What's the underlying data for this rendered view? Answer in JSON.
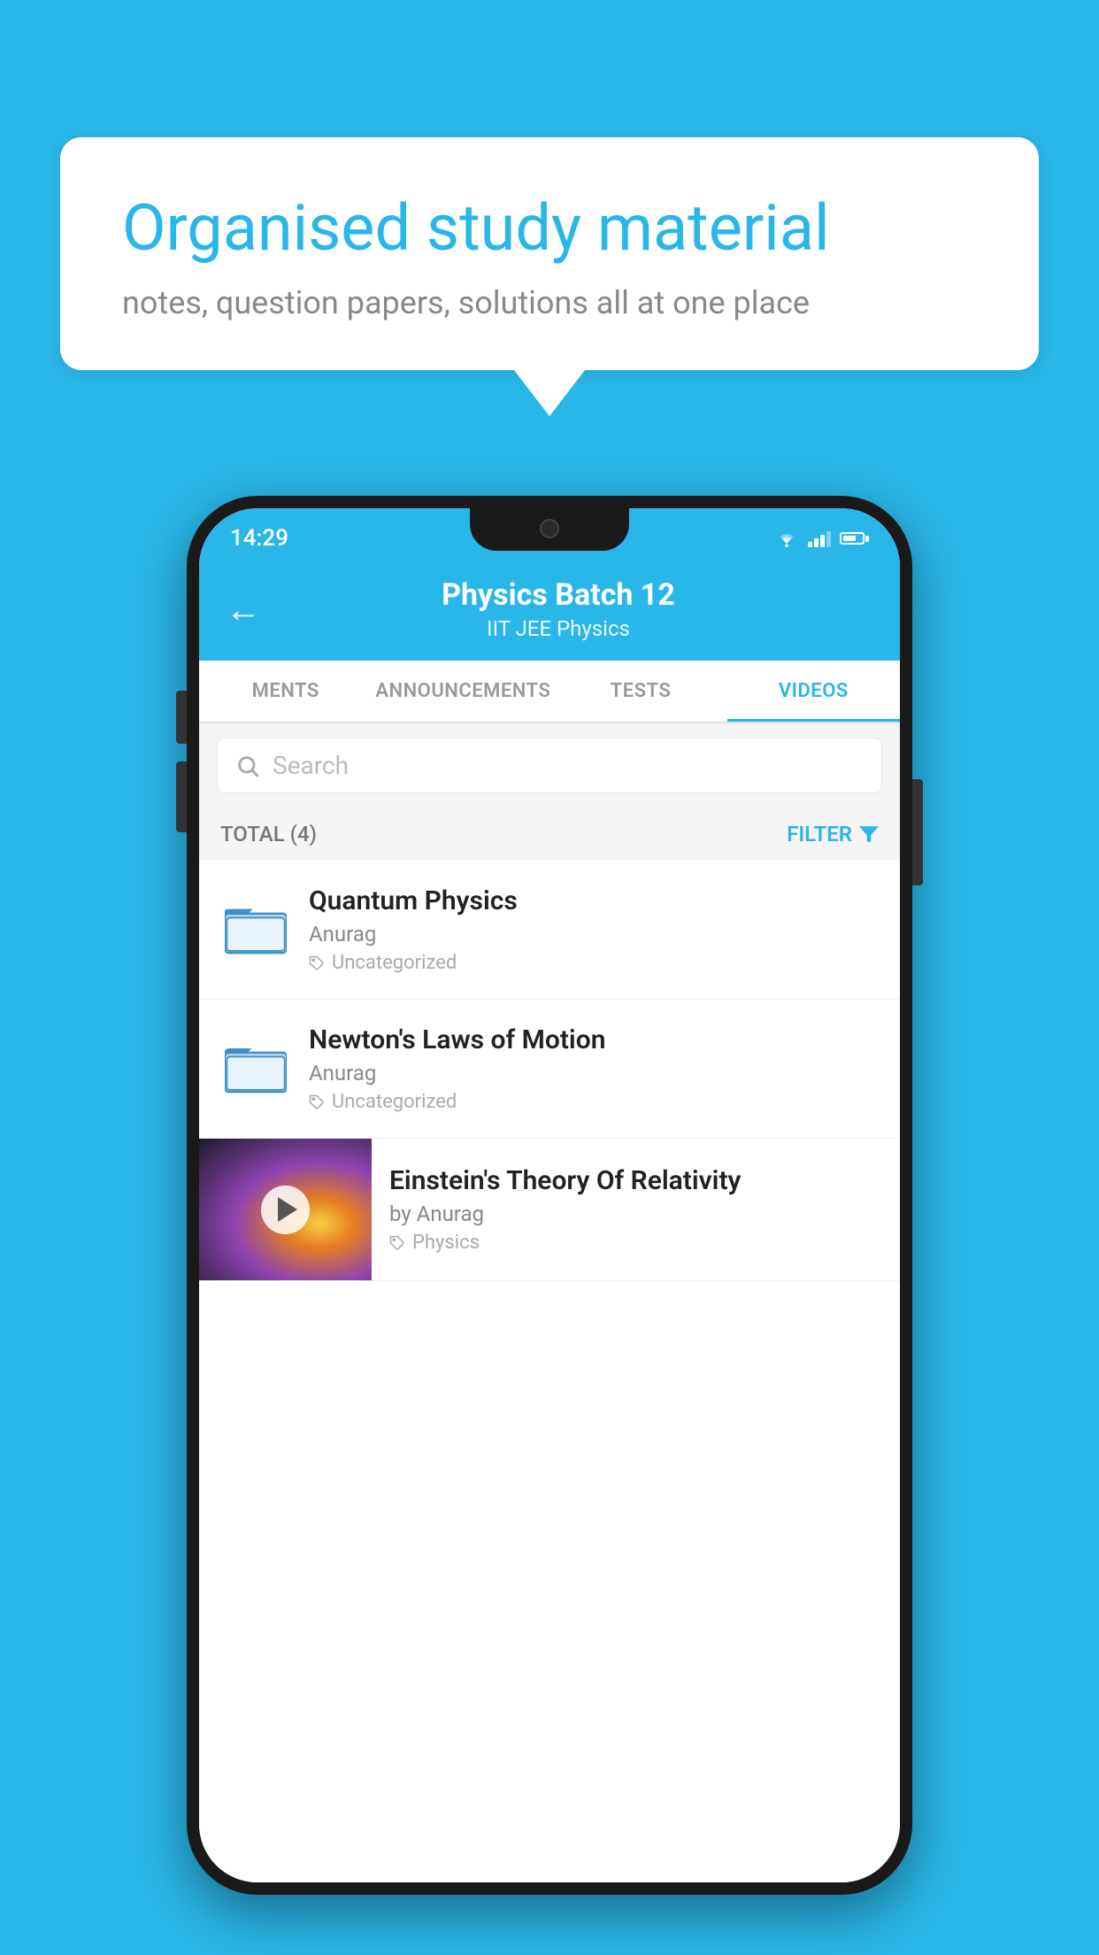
{
  "background_color": "#29b6e8",
  "speech_bubble": {
    "title": "Organised study material",
    "subtitle": "notes, question papers, solutions all at one place"
  },
  "phone": {
    "status_bar": {
      "time": "14:29"
    },
    "header": {
      "back_label": "←",
      "title": "Physics Batch 12",
      "subtitle": "IIT JEE   Physics"
    },
    "tabs": [
      {
        "label": "MENTS",
        "active": false
      },
      {
        "label": "ANNOUNCEMENTS",
        "active": false
      },
      {
        "label": "TESTS",
        "active": false
      },
      {
        "label": "VIDEOS",
        "active": true
      }
    ],
    "search": {
      "placeholder": "Search"
    },
    "filter_row": {
      "total_label": "TOTAL (4)",
      "filter_label": "FILTER"
    },
    "list_items": [
      {
        "id": 1,
        "type": "folder",
        "title": "Quantum Physics",
        "author": "Anurag",
        "tag": "Uncategorized"
      },
      {
        "id": 2,
        "type": "folder",
        "title": "Newton's Laws of Motion",
        "author": "Anurag",
        "tag": "Uncategorized"
      },
      {
        "id": 3,
        "type": "video",
        "title": "Einstein's Theory Of Relativity",
        "author": "by Anurag",
        "tag": "Physics"
      }
    ]
  }
}
